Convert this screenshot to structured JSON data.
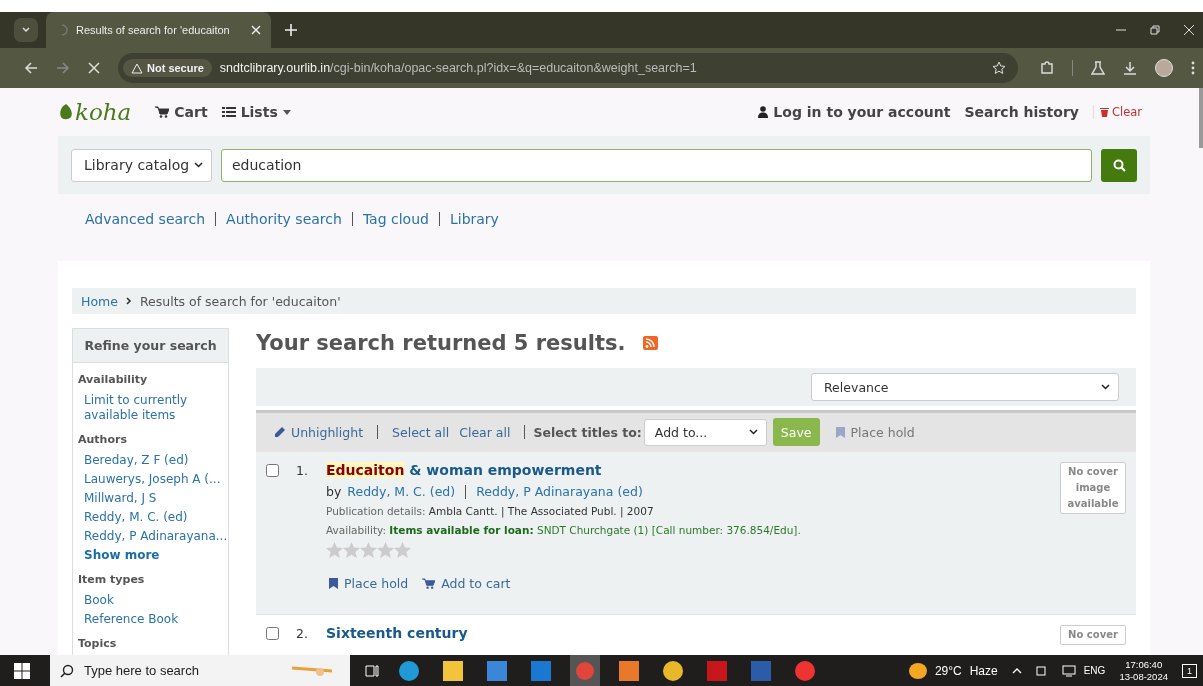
{
  "browser": {
    "tab_title": "Results of search for 'educaiton",
    "security": "Not secure",
    "url_host": "sndtclibrary.ourlib.in",
    "url_path": "/cgi-bin/koha/opac-search.pl?idx=&q=educaiton&weight_search=1"
  },
  "header": {
    "logo": "koha",
    "cart": "Cart",
    "lists": "Lists",
    "login": "Log in to your account",
    "search_history": "Search history",
    "clear": "Clear"
  },
  "search": {
    "scope": "Library catalog",
    "query": "education"
  },
  "links": [
    "Advanced search",
    "Authority search",
    "Tag cloud",
    "Library"
  ],
  "breadcrumb": {
    "home": "Home",
    "current": "Results of search for 'educaiton'"
  },
  "sidebar": {
    "title": "Refine your search",
    "groups": [
      {
        "heading": "Availability",
        "items": [
          {
            "label": "Limit to currently available items",
            "kind": "link"
          }
        ]
      },
      {
        "heading": "Authors",
        "items": [
          {
            "label": "Bereday, Z F (ed)",
            "kind": "link"
          },
          {
            "label": "Lauwerys, Joseph A (...",
            "kind": "link"
          },
          {
            "label": "Millward, J S",
            "kind": "link"
          },
          {
            "label": "Reddy, M. C. (ed)",
            "kind": "link"
          },
          {
            "label": "Reddy, P Adinarayana...",
            "kind": "link"
          },
          {
            "label": "Show more",
            "kind": "more"
          }
        ]
      },
      {
        "heading": "Item types",
        "items": [
          {
            "label": "Book",
            "kind": "link"
          },
          {
            "label": "Reference Book",
            "kind": "link"
          }
        ]
      },
      {
        "heading": "Topics"
      }
    ]
  },
  "results": {
    "heading": "Your search returned 5 results.",
    "sort": "Relevance",
    "toolbar": {
      "unhighlight": "Unhighlight",
      "select_all": "Select all",
      "clear_all": "Clear all",
      "select_titles": "Select titles to:",
      "add_to": "Add to...",
      "save": "Save",
      "place_hold": "Place hold"
    },
    "records": [
      {
        "checked": false,
        "number": "1.",
        "title_highlight": "Educaiton",
        "title_rest": "& woman empowerment",
        "by": "by",
        "authors": [
          "Reddy, M. C. (ed)",
          "Reddy, P Adinarayana (ed)"
        ],
        "publication_label": "Publication details:",
        "publication": "Ambla Cantt. | The Associated Publ. | 2007",
        "availability_label": "Availability:",
        "availability_status": "Items available for loan:",
        "availability_detail": "SNDT Churchgate (1) [Call number: 376.854/Edu].",
        "stars": 0,
        "place_hold": "Place hold",
        "add_to_cart": "Add to cart",
        "cover": "No cover image available"
      },
      {
        "checked": false,
        "number": "2.",
        "title_rest": "Sixteenth century",
        "cover": "No cover"
      }
    ]
  },
  "taskbar": {
    "search_placeholder": "Type here to search",
    "temperature": "29°C",
    "weather": "Haze",
    "language": "ENG",
    "time": "17:06:40",
    "date": "13-08-2024",
    "notifications": "1"
  }
}
